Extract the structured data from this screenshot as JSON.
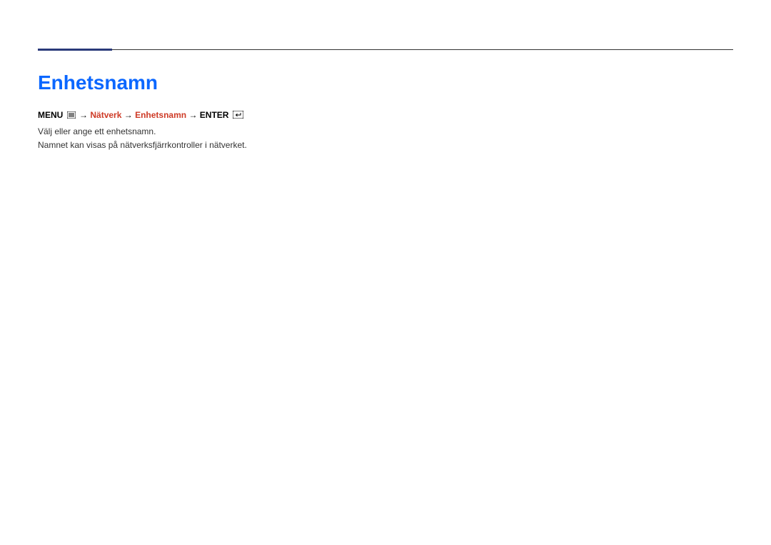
{
  "section": {
    "title": "Enhetsnamn"
  },
  "breadcrumb": {
    "menu_label": "MENU",
    "enter_label": "ENTER",
    "arrow": "→",
    "path_item_1": "Nätverk",
    "path_item_2": "Enhetsnamn"
  },
  "body": {
    "line1": "Välj eller ange ett enhetsnamn.",
    "line2": "Namnet kan visas på nätverksfjärrkontroller i nätverket."
  }
}
